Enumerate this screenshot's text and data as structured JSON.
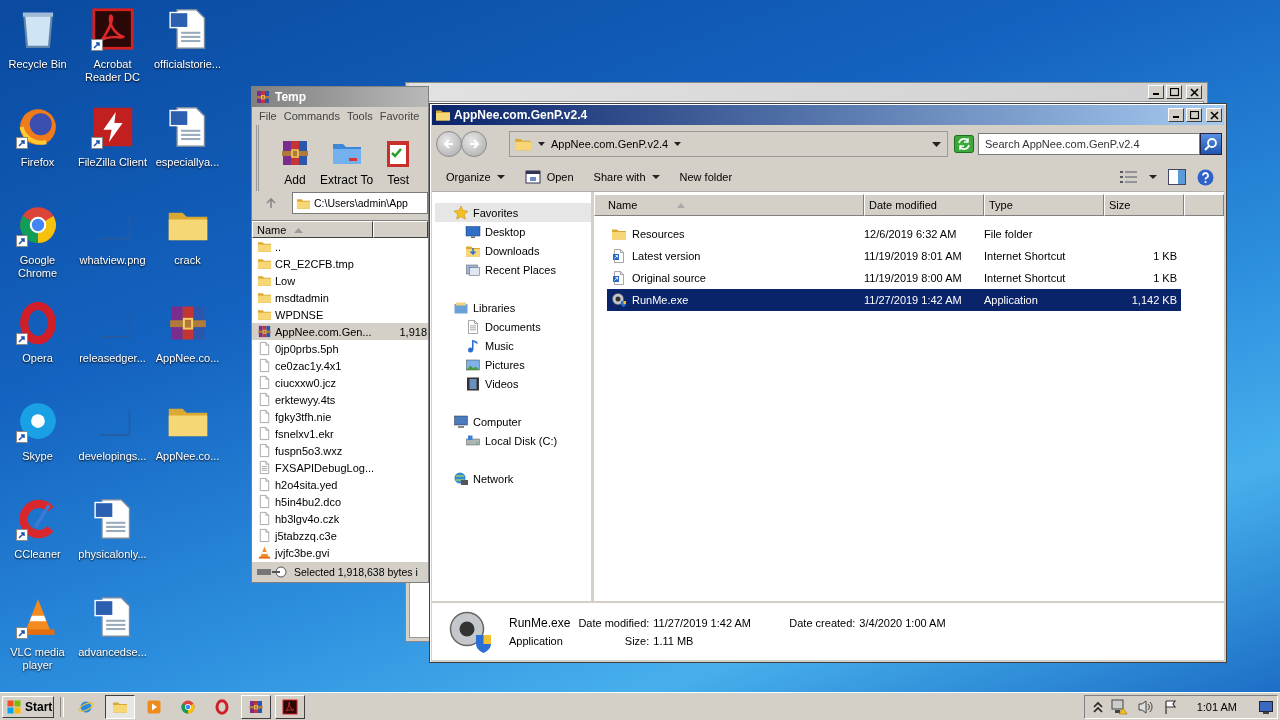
{
  "desktop_icons": [
    {
      "label": "Recycle Bin",
      "kind": "recycle",
      "shortcut": false
    },
    {
      "label": "Firefox",
      "kind": "firefox",
      "shortcut": true
    },
    {
      "label": "Google Chrome",
      "kind": "chrome",
      "shortcut": true
    },
    {
      "label": "Opera",
      "kind": "opera",
      "shortcut": true
    },
    {
      "label": "Skype",
      "kind": "skype",
      "shortcut": true
    },
    {
      "label": "CCleaner",
      "kind": "ccleaner",
      "shortcut": true
    },
    {
      "label": "VLC media player",
      "kind": "vlc",
      "shortcut": true
    },
    {
      "label": "Acrobat Reader DC",
      "kind": "acrobat",
      "shortcut": true
    },
    {
      "label": "FileZilla Client",
      "kind": "filezilla",
      "shortcut": true
    },
    {
      "label": "whatview.png",
      "kind": "blank",
      "shortcut": false
    },
    {
      "label": "releasedger...",
      "kind": "blank",
      "shortcut": false
    },
    {
      "label": "developings...",
      "kind": "blank",
      "shortcut": false
    },
    {
      "label": "physicalonly...",
      "kind": "word",
      "shortcut": false
    },
    {
      "label": "advancedse...",
      "kind": "word",
      "shortcut": false
    },
    {
      "label": "officialstorie...",
      "kind": "word",
      "shortcut": false
    },
    {
      "label": "especiallya...",
      "kind": "word",
      "shortcut": false
    },
    {
      "label": "crack",
      "kind": "folder",
      "shortcut": false
    },
    {
      "label": "AppNee.co...",
      "kind": "winrar",
      "shortcut": false
    },
    {
      "label": "AppNee.co...",
      "kind": "folder",
      "shortcut": false
    }
  ],
  "winrar_window": {
    "title": "Temp",
    "menu": [
      "File",
      "Commands",
      "Tools",
      "Favorite"
    ],
    "toolbar": [
      {
        "label": "Add",
        "kind": "winrar"
      },
      {
        "label": "Extract To",
        "kind": "extract"
      },
      {
        "label": "Test",
        "kind": "test"
      }
    ],
    "path": "C:\\Users\\admin\\App",
    "columns": [
      "Name"
    ],
    "rows": [
      {
        "name": "..",
        "kind": "folder",
        "selected": false
      },
      {
        "name": "CR_E2CFB.tmp",
        "kind": "folder",
        "selected": false
      },
      {
        "name": "Low",
        "kind": "folder",
        "selected": false
      },
      {
        "name": "msdtadmin",
        "kind": "folder",
        "selected": false
      },
      {
        "name": "WPDNSE",
        "kind": "folder",
        "selected": false
      },
      {
        "name": "AppNee.com.Gen...",
        "kind": "winrar",
        "size": "1,918",
        "selected": true
      },
      {
        "name": "0jp0prbs.5ph",
        "kind": "file",
        "selected": false
      },
      {
        "name": "ce0zac1y.4x1",
        "kind": "file",
        "selected": false
      },
      {
        "name": "ciucxxw0.jcz",
        "kind": "file",
        "selected": false
      },
      {
        "name": "erktewyy.4ts",
        "kind": "file",
        "selected": false
      },
      {
        "name": "fgky3tfh.nie",
        "kind": "file",
        "selected": false
      },
      {
        "name": "fsnelxv1.ekr",
        "kind": "file",
        "selected": false
      },
      {
        "name": "fuspn5o3.wxz",
        "kind": "file",
        "selected": false
      },
      {
        "name": "FXSAPIDebugLog...",
        "kind": "textfile",
        "selected": false
      },
      {
        "name": "h2o4sita.yed",
        "kind": "file",
        "selected": false
      },
      {
        "name": "h5in4bu2.dco",
        "kind": "file",
        "selected": false
      },
      {
        "name": "hb3lgv4o.czk",
        "kind": "file",
        "selected": false
      },
      {
        "name": "j5tabzzq.c3e",
        "kind": "file",
        "selected": false
      },
      {
        "name": "jvjfc3be.gvi",
        "kind": "vlc",
        "selected": false
      }
    ],
    "status": "Selected 1,918,638 bytes i"
  },
  "explorer_window": {
    "title": "AppNee.com.GenP.v2.4",
    "breadcrumb": "AppNee.com.GenP.v2.4",
    "search": {
      "placeholder": "Search AppNee.com.GenP.v2.4"
    },
    "toolbar": [
      {
        "label": "Organize",
        "kind": "menu"
      },
      {
        "label": "Open",
        "kind": "icon"
      },
      {
        "label": "Share with",
        "kind": "menu"
      },
      {
        "label": "New folder",
        "kind": "plain"
      }
    ],
    "nav": [
      {
        "label": "Favorites",
        "kind": "star",
        "selected": true,
        "children": [
          {
            "label": "Desktop",
            "kind": "desktop",
            "selected": false
          },
          {
            "label": "Downloads",
            "kind": "downloads",
            "selected": false
          },
          {
            "label": "Recent Places",
            "kind": "recent",
            "selected": false
          }
        ]
      },
      {
        "label": "Libraries",
        "kind": "library",
        "selected": false,
        "children": [
          {
            "label": "Documents",
            "kind": "documents",
            "selected": false
          },
          {
            "label": "Music",
            "kind": "music",
            "selected": false
          },
          {
            "label": "Pictures",
            "kind": "pictures",
            "selected": false
          },
          {
            "label": "Videos",
            "kind": "videos",
            "selected": false
          }
        ]
      },
      {
        "label": "Computer",
        "kind": "computer",
        "selected": false,
        "children": [
          {
            "label": "Local Disk (C:)",
            "kind": "disk",
            "selected": false
          }
        ]
      },
      {
        "label": "Network",
        "kind": "network",
        "selected": false
      }
    ],
    "columns": [
      "Name",
      "Date modified",
      "Type",
      "Size"
    ],
    "files": [
      {
        "name": "Resources",
        "kind": "folder",
        "date": "12/6/2019 6:32 AM",
        "type": "File folder",
        "selected": false
      },
      {
        "name": "Latest version",
        "kind": "link",
        "date": "11/19/2019 8:01 AM",
        "type": "Internet Shortcut",
        "size": "1 KB",
        "selected": false
      },
      {
        "name": "Original source",
        "kind": "link",
        "date": "11/19/2019 8:00 AM",
        "type": "Internet Shortcut",
        "size": "1 KB",
        "selected": false
      },
      {
        "name": "RunMe.exe",
        "kind": "exe",
        "date": "11/27/2019 1:42 AM",
        "type": "Application",
        "size": "1,142 KB",
        "selected": true
      }
    ],
    "details": {
      "name": "RunMe.exe",
      "type": "Application",
      "modified_label": "Date modified:",
      "modified": "11/27/2019 1:42 AM",
      "size_label": "Size:",
      "size": "1.11 MB",
      "created_label": "Date created:",
      "created": "3/4/2020 1:00 AM"
    }
  },
  "taskbar": {
    "start": "Start",
    "items": [
      {
        "kind": "ie",
        "running": false,
        "selected": false
      },
      {
        "kind": "explorer",
        "running": true,
        "selected": true
      },
      {
        "kind": "media",
        "running": false,
        "selected": false
      },
      {
        "kind": "chrome",
        "running": false,
        "selected": false
      },
      {
        "kind": "opera",
        "running": false,
        "selected": false
      },
      {
        "kind": "winrar",
        "running": true,
        "selected": false
      },
      {
        "kind": "acrobat",
        "running": true,
        "selected": false
      }
    ],
    "clock": "1:01 AM"
  }
}
